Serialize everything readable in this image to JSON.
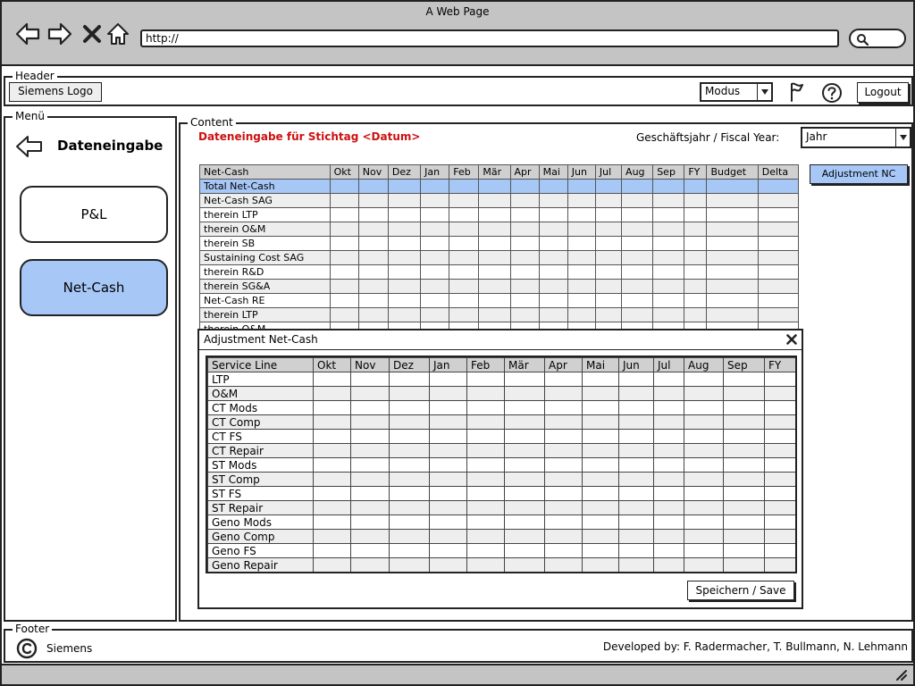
{
  "window": {
    "title": "A Web Page",
    "url": "http://"
  },
  "header": {
    "legend": "Header",
    "logo": "Siemens Logo",
    "modus_label": "Modus",
    "logout_label": "Logout"
  },
  "menu": {
    "legend": "Menü",
    "title": "Dateneingabe",
    "items": [
      {
        "label": "P&L"
      },
      {
        "label": "Net-Cash"
      }
    ]
  },
  "content": {
    "legend": "Content",
    "title": "Dateneingabe für Stichtag <Datum>",
    "fiscal_label": "Geschäftsjahr / Fiscal Year:",
    "fiscal_value": "Jahr",
    "adjustment_button": "Adjustment NC",
    "table": {
      "headers": [
        "Net-Cash",
        "Okt",
        "Nov",
        "Dez",
        "Jan",
        "Feb",
        "Mär",
        "Apr",
        "Mai",
        "Jun",
        "Jul",
        "Aug",
        "Sep",
        "FY",
        "Budget",
        "Delta"
      ],
      "rows": [
        "Total Net-Cash",
        "Net-Cash SAG",
        "therein LTP",
        "therein O&M",
        "therein SB",
        "Sustaining Cost SAG",
        "therein R&D",
        "therein SG&A",
        "Net-Cash RE",
        "therein LTP",
        "therein O&M"
      ],
      "selected_row": 0
    }
  },
  "modal": {
    "title": "Adjustment Net-Cash",
    "table": {
      "headers": [
        "Service Line",
        "Okt",
        "Nov",
        "Dez",
        "Jan",
        "Feb",
        "Mär",
        "Apr",
        "Mai",
        "Jun",
        "Jul",
        "Aug",
        "Sep",
        "FY"
      ],
      "rows": [
        "LTP",
        "O&M",
        "CT Mods",
        "CT Comp",
        "CT FS",
        "CT Repair",
        "ST Mods",
        "ST Comp",
        "ST FS",
        "ST Repair",
        "Geno Mods",
        "Geno Comp",
        "Geno FS",
        "Geno Repair"
      ]
    },
    "save_label": "Speichern / Save"
  },
  "footer": {
    "legend": "Footer",
    "company": "Siemens",
    "credits": "Developed by: F. Radermacher, T. Bullmann, N. Lehmann"
  }
}
